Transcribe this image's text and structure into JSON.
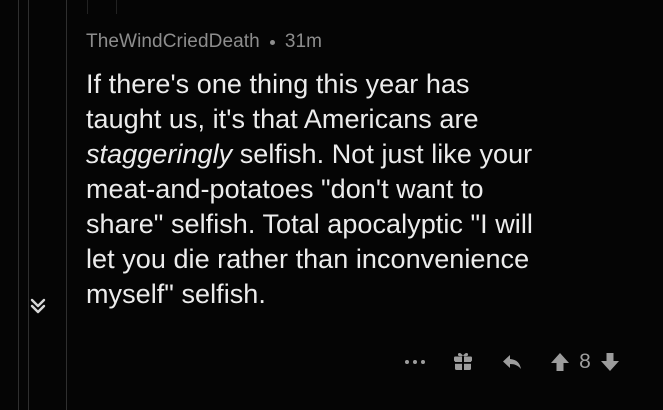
{
  "comment": {
    "author": "TheWindCriedDeath",
    "time": "31m",
    "body": {
      "line1": "If there's one thing this year has",
      "line2": "taught us, it's that Americans are",
      "line3_em": "staggeringly",
      "line3_rest": " selfish. Not just like your",
      "line4": "meat-and-potatoes \"don't want to",
      "line5": "share\" selfish. Total apocalyptic \"I will",
      "line6": "let you die rather than inconvenience",
      "line7": "myself\" selfish."
    }
  },
  "actions": {
    "score": "8"
  },
  "icons": {
    "collapse": "chevrons-down-icon",
    "more": "more-icon",
    "award": "gift-icon",
    "reply": "reply-icon",
    "upvote": "upvote-icon",
    "downvote": "downvote-icon"
  },
  "colors": {
    "background": "#050505",
    "text": "#ececec",
    "meta": "#8d8d8d",
    "icon": "#9d9d9d",
    "thread_line": "#2f2f2f"
  }
}
